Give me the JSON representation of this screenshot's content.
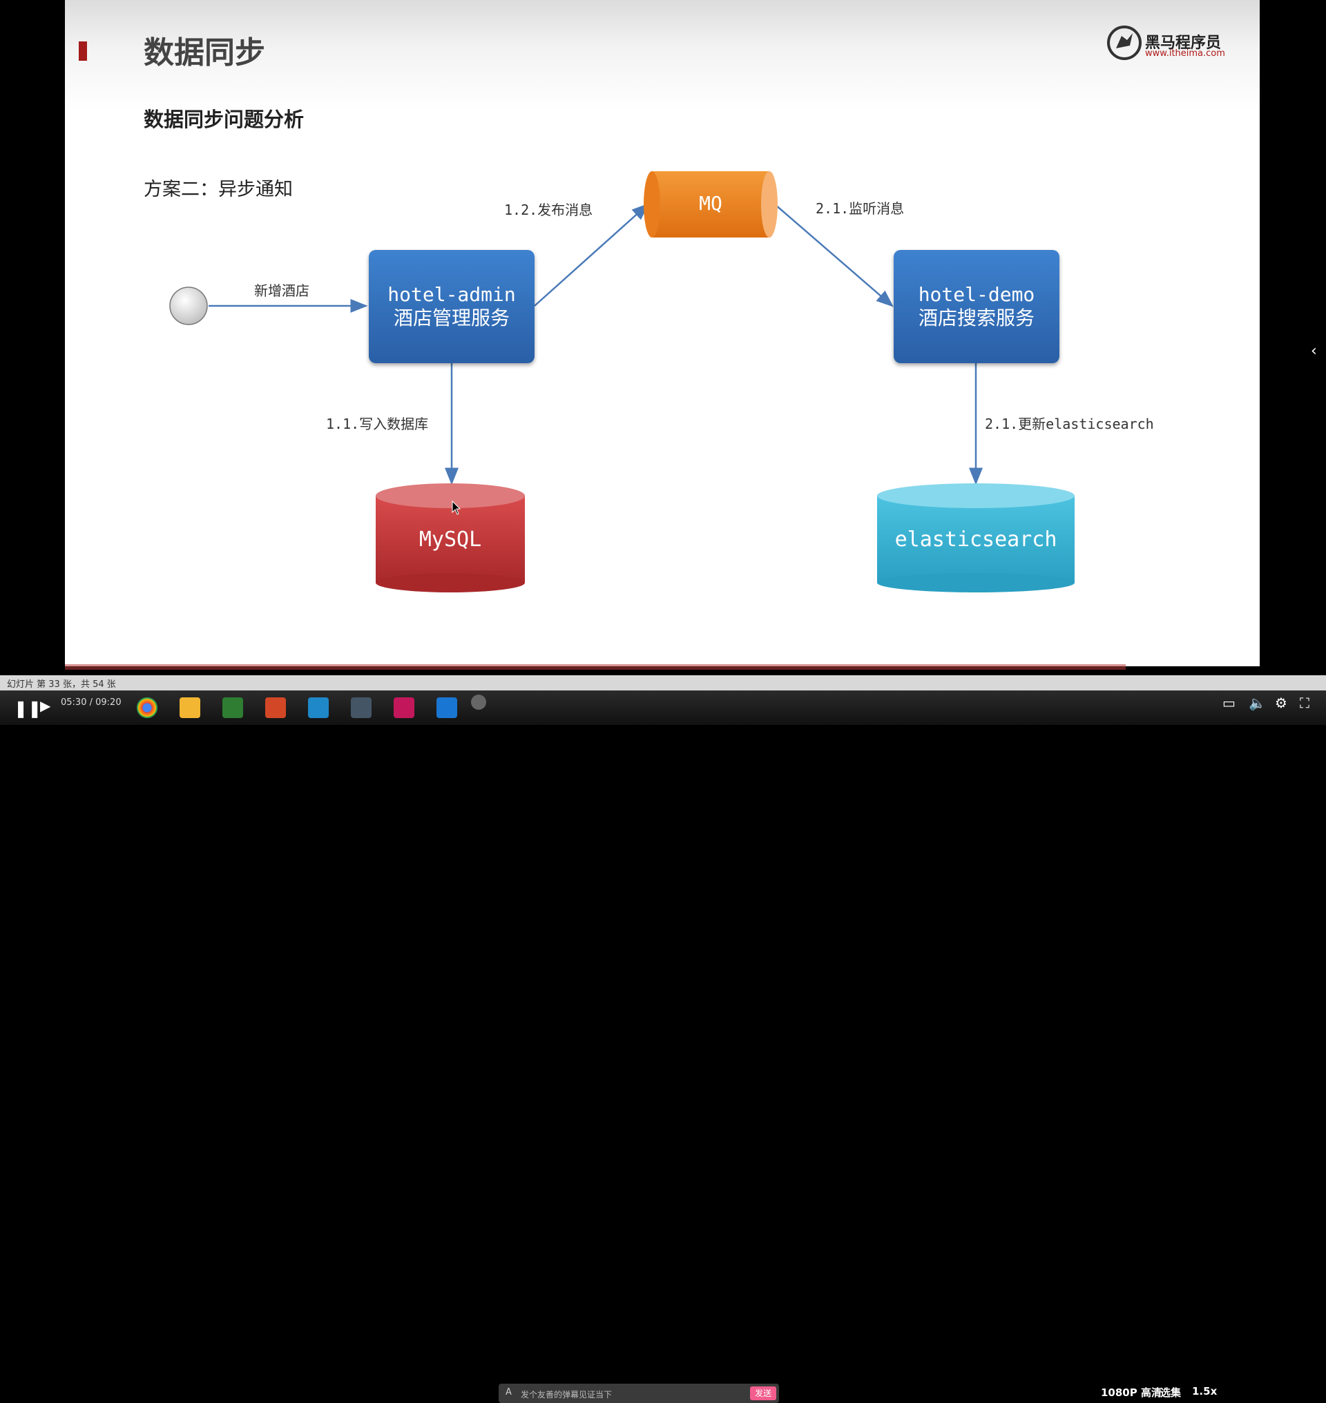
{
  "slide": {
    "title": "数据同步",
    "subtitle": "数据同步问题分析",
    "plan": "方案二：异步通知",
    "logo_cn": "黑马程序员",
    "logo_en": "www.itheima.com"
  },
  "diagram": {
    "mq": "MQ",
    "hotel_admin": {
      "line1": "hotel-admin",
      "line2": "酒店管理服务"
    },
    "hotel_demo": {
      "line1": "hotel-demo",
      "line2": "酒店搜索服务"
    },
    "mysql": "MySQL",
    "elasticsearch": "elasticsearch",
    "labels": {
      "add_hotel": "新增酒店",
      "write_db": "1.1.写入数据库",
      "publish": "1.2.发布消息",
      "listen": "2.1.监听消息",
      "update_es": "2.1.更新elasticsearch"
    }
  },
  "status_bar": {
    "slide_info": "幻灯片 第 33 张，共 54 张"
  },
  "player": {
    "time_current": "05:30",
    "time_total": "09:20",
    "progress": 0.59,
    "danmaku_placeholder": "发个友善的弹幕见证当下",
    "send_label": "发送",
    "quality": "1080P 高清",
    "episodes": "选集",
    "speed": "1.5x"
  },
  "colors": {
    "accent_red": "#a31b1b",
    "box_blue": "#3572bf",
    "mq_orange": "#f08a24",
    "mysql_red": "#c9383a",
    "es_cyan": "#35b5d6",
    "progress_pink": "#f25d8e"
  }
}
